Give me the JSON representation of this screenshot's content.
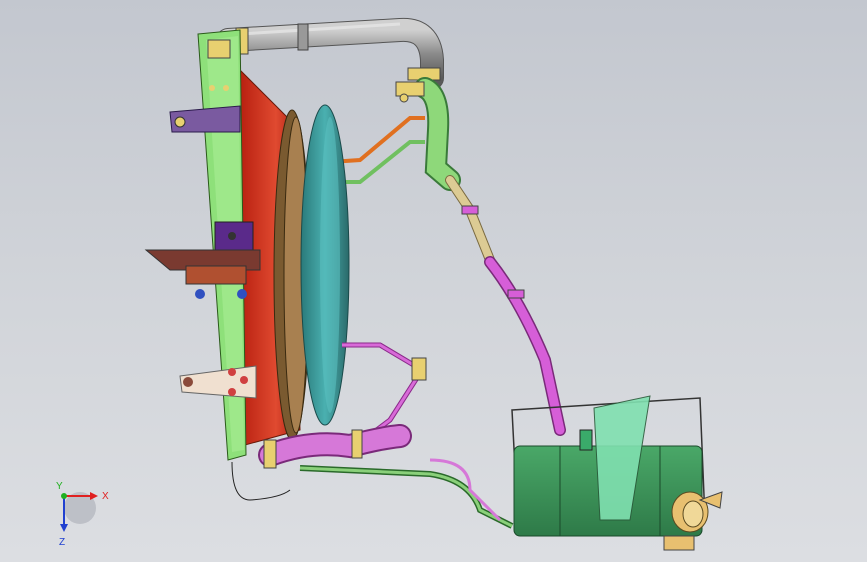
{
  "viewport": {
    "triad": {
      "x_label": "X",
      "y_label": "Y",
      "z_label": "Z",
      "x_color": "#e02020",
      "y_color": "#20b020",
      "z_color": "#2040d0"
    }
  },
  "colors": {
    "radiator_frame": "#90e070",
    "fan_shroud": "#d83a2a",
    "fan_ring": "#8a6a3a",
    "fan_blade": "#3a9a9a",
    "pipe_gray": "#8e8e8e",
    "pipe_green": "#7acc6a",
    "pipe_magenta": "#d040d8",
    "pipe_tan": "#d8c890",
    "tank": "#3f9a5a",
    "tank_bracket": "#80e0b0",
    "cap": "#e8c070",
    "bracket_purple": "#6a3a9a",
    "clamp_orange": "#e07020"
  }
}
